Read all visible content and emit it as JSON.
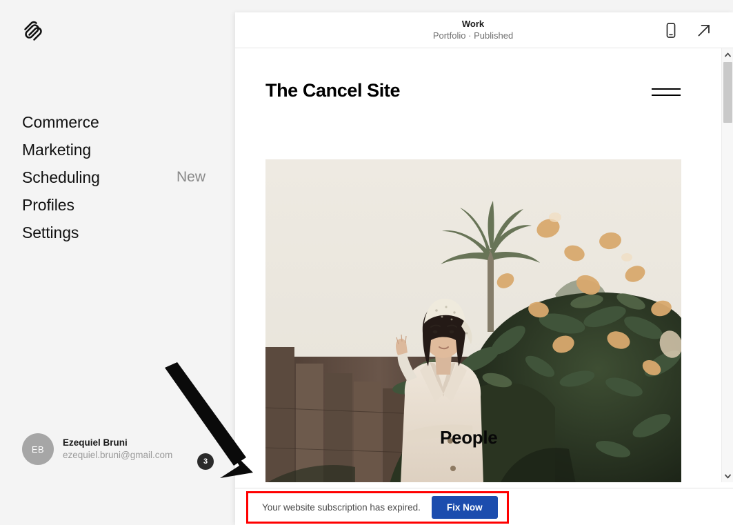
{
  "brand": {
    "logo_icon": "squarespace-logo"
  },
  "sidebar": {
    "nav": [
      {
        "label": "Commerce",
        "badge": ""
      },
      {
        "label": "Marketing",
        "badge": ""
      },
      {
        "label": "Scheduling",
        "badge": "New"
      },
      {
        "label": "Profiles",
        "badge": ""
      },
      {
        "label": "Settings",
        "badge": ""
      }
    ],
    "account": {
      "initials": "EB",
      "name": "Ezequiel Bruni",
      "email": "ezequiel.bruni@gmail.com"
    }
  },
  "preview": {
    "title": "Work",
    "subtitle": "Portfolio · Published",
    "mobile_icon": "mobile-device-icon",
    "open_icon": "external-link-arrow-icon",
    "site": {
      "title": "The Cancel Site",
      "menu_icon": "hamburger-menu-icon",
      "hero_caption": "People"
    },
    "scrollbar": {
      "up_icon": "chevron-up-icon",
      "down_icon": "chevron-down-icon"
    }
  },
  "notification": {
    "message": "Your website subscription has expired.",
    "action_label": "Fix Now",
    "highlight_color": "#ff0000",
    "button_color": "#1c4dae"
  },
  "annotations": {
    "arrow_icon": "pointer-arrow-icon",
    "badge_count": "3"
  }
}
